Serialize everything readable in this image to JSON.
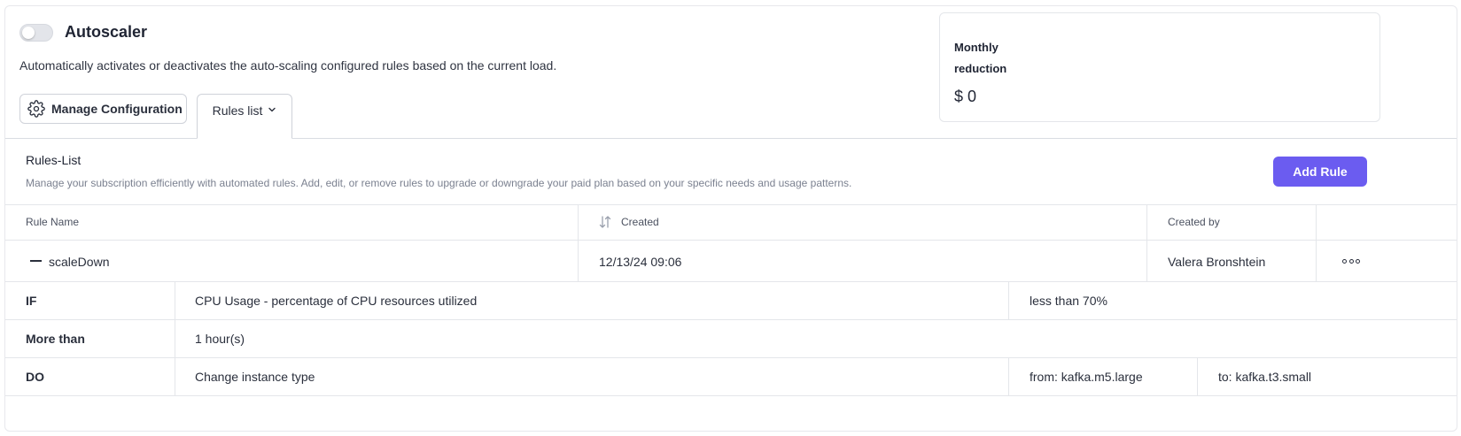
{
  "header": {
    "title": "Autoscaler",
    "toggle_on": false,
    "description": "Automatically activates or deactivates the auto-scaling configured rules based on the current load."
  },
  "actions": {
    "manage_label": "Manage Configuration",
    "rules_tab_label": "Rules list"
  },
  "summary_card": {
    "label": "Monthly reduction",
    "value": "$ 0"
  },
  "rules_list": {
    "title": "Rules-List",
    "description": "Manage your subscription efficiently with automated rules. Add, edit, or remove rules to upgrade or downgrade your paid plan based on your specific needs and usage patterns.",
    "add_label": "Add Rule",
    "columns": {
      "name": "Rule Name",
      "created": "Created",
      "created_by": "Created by"
    },
    "rule": {
      "name": "scaleDown",
      "created": "12/13/24 09:06",
      "created_by": "Valera Bronshtein",
      "condition": {
        "label": "IF",
        "metric": "CPU Usage - percentage of CPU resources utilized",
        "threshold": "less than 70%"
      },
      "duration": {
        "label": "More than",
        "value": "1 hour(s)"
      },
      "action": {
        "label": "DO",
        "value": "Change instance type",
        "from": "from: kafka.m5.large",
        "to": "to: kafka.t3.small"
      }
    }
  },
  "colors": {
    "accent": "#6b5cf0",
    "border": "#e4e6ea",
    "muted_text": "#7b8190"
  },
  "icons": [
    "gear-icon",
    "chevron-down-icon",
    "sort-icon",
    "collapse-icon",
    "more-options-icon"
  ]
}
